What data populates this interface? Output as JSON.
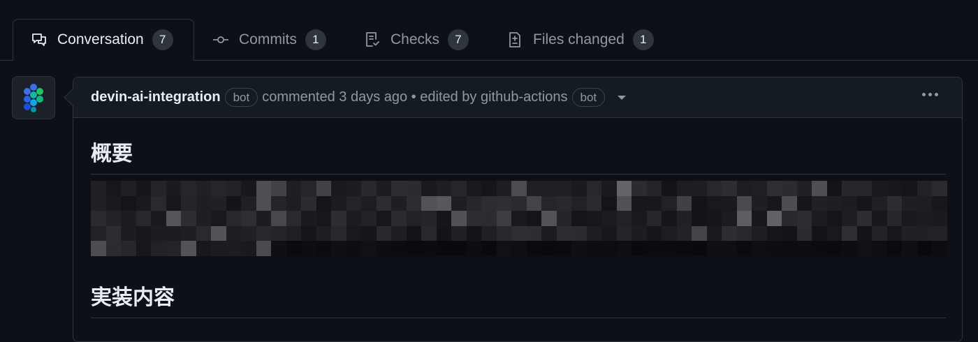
{
  "tabs": [
    {
      "label": "Conversation",
      "count": "7",
      "icon": "comment-discussion-icon",
      "active": true
    },
    {
      "label": "Commits",
      "count": "1",
      "icon": "git-commit-icon",
      "active": false
    },
    {
      "label": "Checks",
      "count": "7",
      "icon": "checklist-icon",
      "active": false
    },
    {
      "label": "Files changed",
      "count": "1",
      "icon": "file-diff-icon",
      "active": false
    }
  ],
  "comment": {
    "author": "devin-ai-integration",
    "author_badge": "bot",
    "action_text": "commented 3 days ago",
    "separator": " • ",
    "edited_text": "edited by github-actions",
    "editor_badge": "bot",
    "headings": {
      "overview": "概要",
      "implementation": "実装内容"
    }
  },
  "colors": {
    "background": "#0d1117",
    "header_background": "#151b23",
    "border": "#30363d",
    "text_primary": "#e6edf3",
    "text_muted": "#9198a1"
  }
}
